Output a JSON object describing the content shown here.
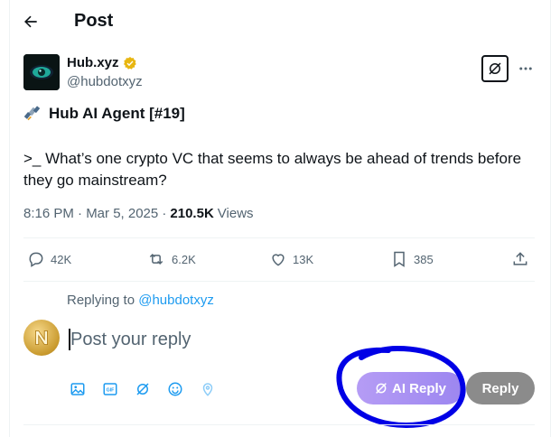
{
  "header": {
    "title": "Post"
  },
  "author": {
    "name": "Hub.xyz",
    "handle": "@hubdotxyz",
    "verified_color": "#e8b611"
  },
  "post": {
    "title": "Hub AI Agent [#19]",
    "text": ">_ What’s one crypto VC that seems to always be ahead of trends before they go mainstream?",
    "time": "8:16 PM · Mar 5, 2025 ·",
    "views_count": "210.5K",
    "views_label": "Views"
  },
  "actions": {
    "replies": "42K",
    "reposts": "6.2K",
    "likes": "13K",
    "bookmarks": "385"
  },
  "reply": {
    "replying_prefix": "Replying to",
    "replying_handle": "@hubdotxyz",
    "placeholder": "Post your reply",
    "ai_reply_label": "AI Reply",
    "reply_label": "Reply"
  },
  "colors": {
    "accent": "#1d9bf0",
    "ai_gradient_start": "#b59cf5",
    "annotation": "#0000e6"
  }
}
